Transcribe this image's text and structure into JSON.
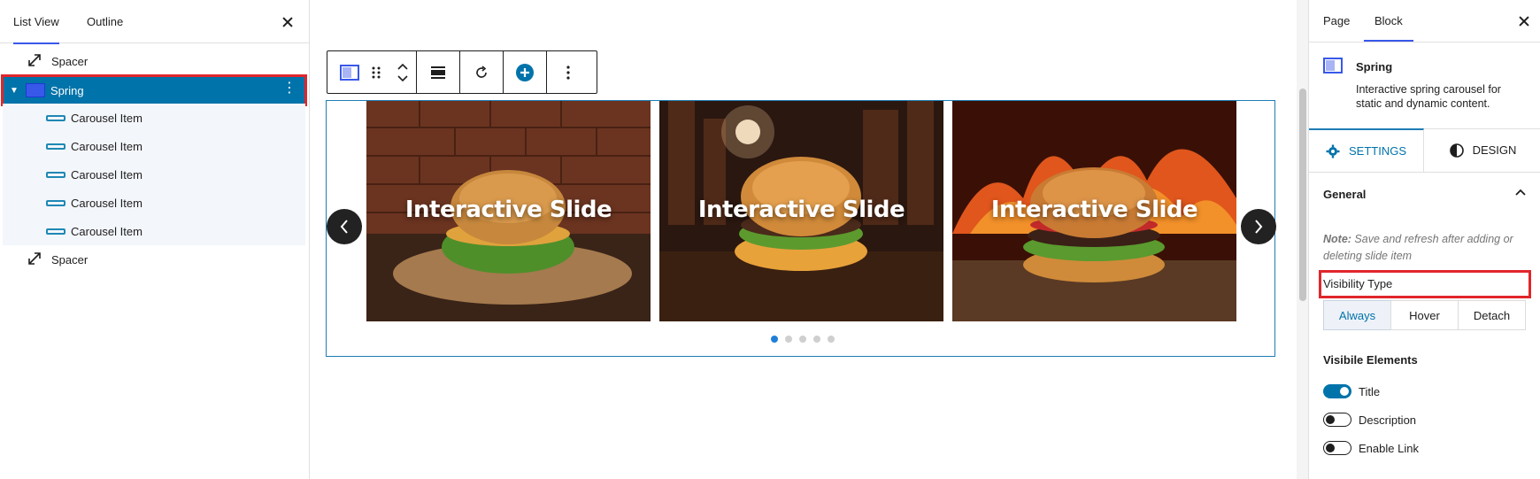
{
  "left_panel": {
    "tabs": [
      {
        "label": "List View",
        "active": true
      },
      {
        "label": "Outline",
        "active": false
      }
    ],
    "items": [
      {
        "label": "Spacer",
        "type": "spacer"
      },
      {
        "label": "Spring",
        "type": "spring",
        "selected": true
      },
      {
        "label": "Carousel Item",
        "type": "carousel-item"
      },
      {
        "label": "Carousel Item",
        "type": "carousel-item"
      },
      {
        "label": "Carousel Item",
        "type": "carousel-item"
      },
      {
        "label": "Carousel Item",
        "type": "carousel-item"
      },
      {
        "label": "Carousel Item",
        "type": "carousel-item"
      },
      {
        "label": "Spacer",
        "type": "spacer"
      }
    ]
  },
  "toolbar": {
    "buttons": [
      "block-type-icon",
      "drag-handle-icon",
      "move-up-down-icon",
      "align-icon",
      "rotate-icon",
      "add-plus-icon",
      "more-options-icon"
    ]
  },
  "slider": {
    "slides": [
      {
        "title": "Interactive Slide"
      },
      {
        "title": "Interactive Slide"
      },
      {
        "title": "Interactive Slide"
      }
    ],
    "dots_total": 5,
    "dots_active": 1,
    "colors": {
      "accent": "#1f7fd8",
      "border": "#1f7db5"
    }
  },
  "right_panel": {
    "tabs": [
      {
        "label": "Page",
        "active": false
      },
      {
        "label": "Block",
        "active": true
      }
    ],
    "block": {
      "name": "Spring",
      "description_line1": "Interactive spring carousel for",
      "description_line2": "static and dynamic content."
    },
    "sub_tabs": [
      {
        "label": "SETTINGS",
        "active": true
      },
      {
        "label": "DESIGN",
        "active": false
      }
    ],
    "general": {
      "heading": "General",
      "note_prefix": "Note:",
      "note_line1": " Save and refresh after adding or",
      "note_line2": "deleting slide item"
    },
    "visibility": {
      "label": "Visibility Type",
      "options": [
        "Always",
        "Hover",
        "Detach"
      ],
      "selected": "Always"
    },
    "visible_elements": {
      "heading": "Visibile Elements",
      "toggles": [
        {
          "label": "Title",
          "on": true
        },
        {
          "label": "Description",
          "on": false
        },
        {
          "label": "Enable Link",
          "on": false
        }
      ]
    }
  }
}
